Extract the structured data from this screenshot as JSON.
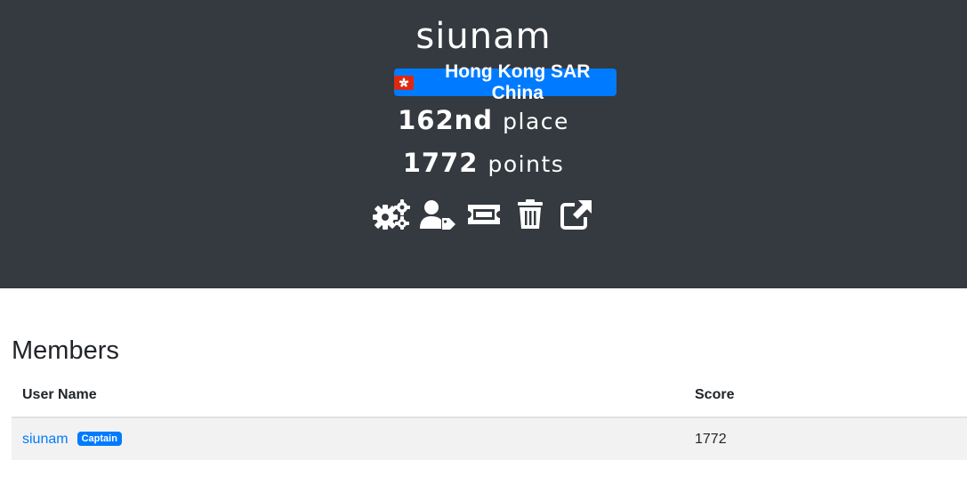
{
  "team": {
    "name": "siunam",
    "country": "Hong Kong SAR China",
    "place_value": "162nd",
    "place_unit": "place",
    "points_value": "1772",
    "points_unit": "points"
  },
  "actions": [
    {
      "icon": "settings-icon"
    },
    {
      "icon": "user-tag-icon"
    },
    {
      "icon": "ticket-icon"
    },
    {
      "icon": "trash-icon"
    },
    {
      "icon": "external-link-icon"
    }
  ],
  "members": {
    "title": "Members",
    "columns": [
      "User Name",
      "Score"
    ],
    "rows": [
      {
        "user": "siunam",
        "badge": "Captain",
        "score": "1772"
      }
    ]
  },
  "colors": {
    "header_bg": "#343a40",
    "accent": "#007bff",
    "row_bg": "#f2f2f2"
  }
}
